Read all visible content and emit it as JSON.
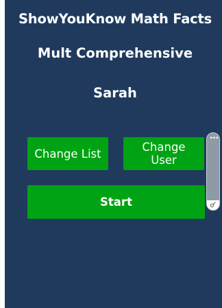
{
  "header": {
    "title": "ShowYouKnow Math Facts",
    "list_name": "Mult Comprehensive",
    "user_name": "Sarah"
  },
  "buttons": {
    "change_list": "Change List",
    "change_user": "Change User",
    "start": "Start"
  },
  "side_handle": {
    "dots": "•••"
  },
  "colors": {
    "background": "#1f3a5c",
    "button": "#00a313",
    "text": "#ffffff"
  },
  "icons": {
    "handle_menu": "more-dots-icon",
    "handle_resize": "resize-icon"
  }
}
